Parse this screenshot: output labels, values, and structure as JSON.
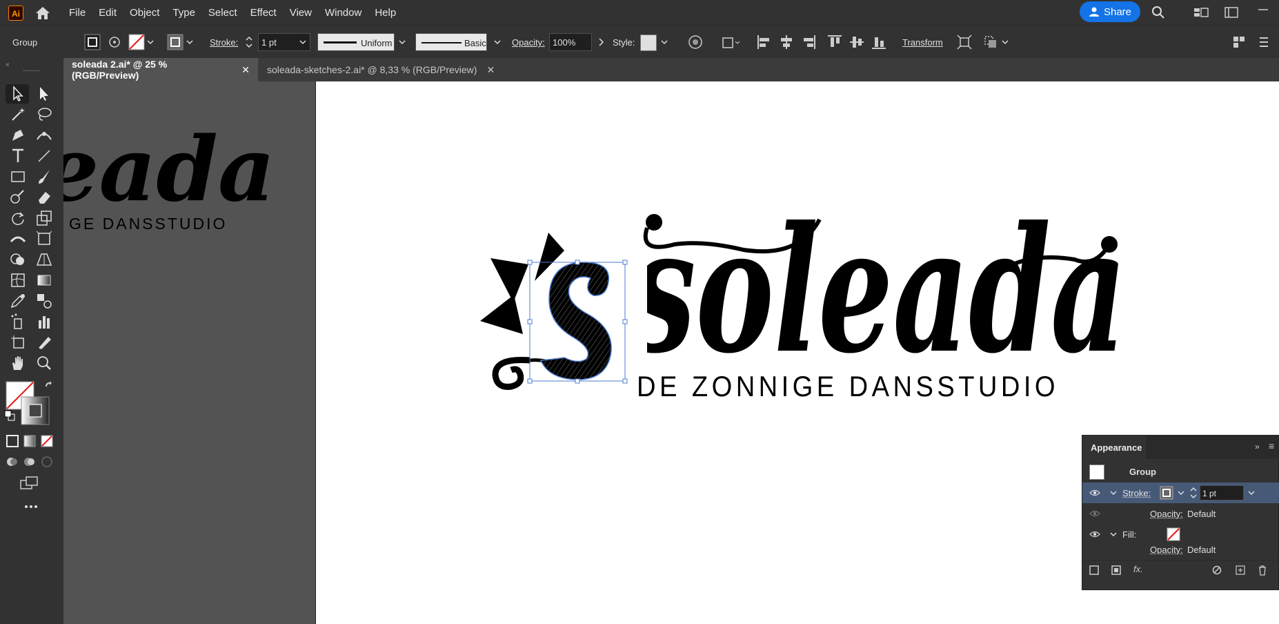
{
  "app": {
    "logo": "Ai"
  },
  "menu": [
    "File",
    "Edit",
    "Object",
    "Type",
    "Select",
    "Effect",
    "View",
    "Window",
    "Help"
  ],
  "share": {
    "label": "Share"
  },
  "control": {
    "selection": "Group",
    "stroke_label": "Stroke:",
    "stroke_value": "1 pt",
    "profile_uniform": "Uniform",
    "brush_basic": "Basic",
    "opacity_label": "Opacity:",
    "opacity_value": "100%",
    "style_label": "Style:",
    "transform": "Transform"
  },
  "tabs": [
    {
      "label": "soleada 2.ai* @ 25 % (RGB/Preview)",
      "close": "✕"
    },
    {
      "label": "soleada-sketches-2.ai* @ 8,33 % (RGB/Preview)",
      "close": "✕"
    }
  ],
  "artwork": {
    "logo_word": "soleada",
    "tagline": "DE ZONNIGE DANSSTUDIO",
    "ghost_word": "eada",
    "ghost_tagline": "GE DANSSTUDIO"
  },
  "appearance": {
    "title": "Appearance",
    "group": "Group",
    "stroke_label": "Stroke:",
    "stroke_value": "1 pt",
    "opacity_label": "Opacity:",
    "opacity_value": "Default",
    "fill_label": "Fill:",
    "opacity2_label": "Opacity:",
    "opacity2_value": "Default",
    "fx": "fx."
  },
  "colors": {
    "accent": "#1473e6",
    "selection": "#4a7bd0",
    "panel": "#323232",
    "canvas": "#535353"
  }
}
